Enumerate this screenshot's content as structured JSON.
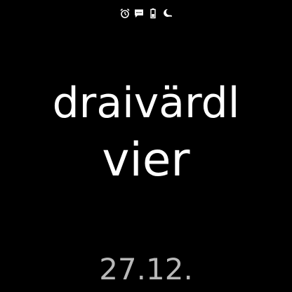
{
  "status_bar": {
    "icons": [
      "alarm-icon",
      "message-icon",
      "battery-icon",
      "do-not-disturb-icon"
    ]
  },
  "clock": {
    "line1": "draivärdl",
    "line2": "vier"
  },
  "date": "27.12.",
  "colors": {
    "background": "#000000",
    "time_text": "#ffffff",
    "date_text": "#b8b8b8",
    "icon": "#ffffff"
  }
}
